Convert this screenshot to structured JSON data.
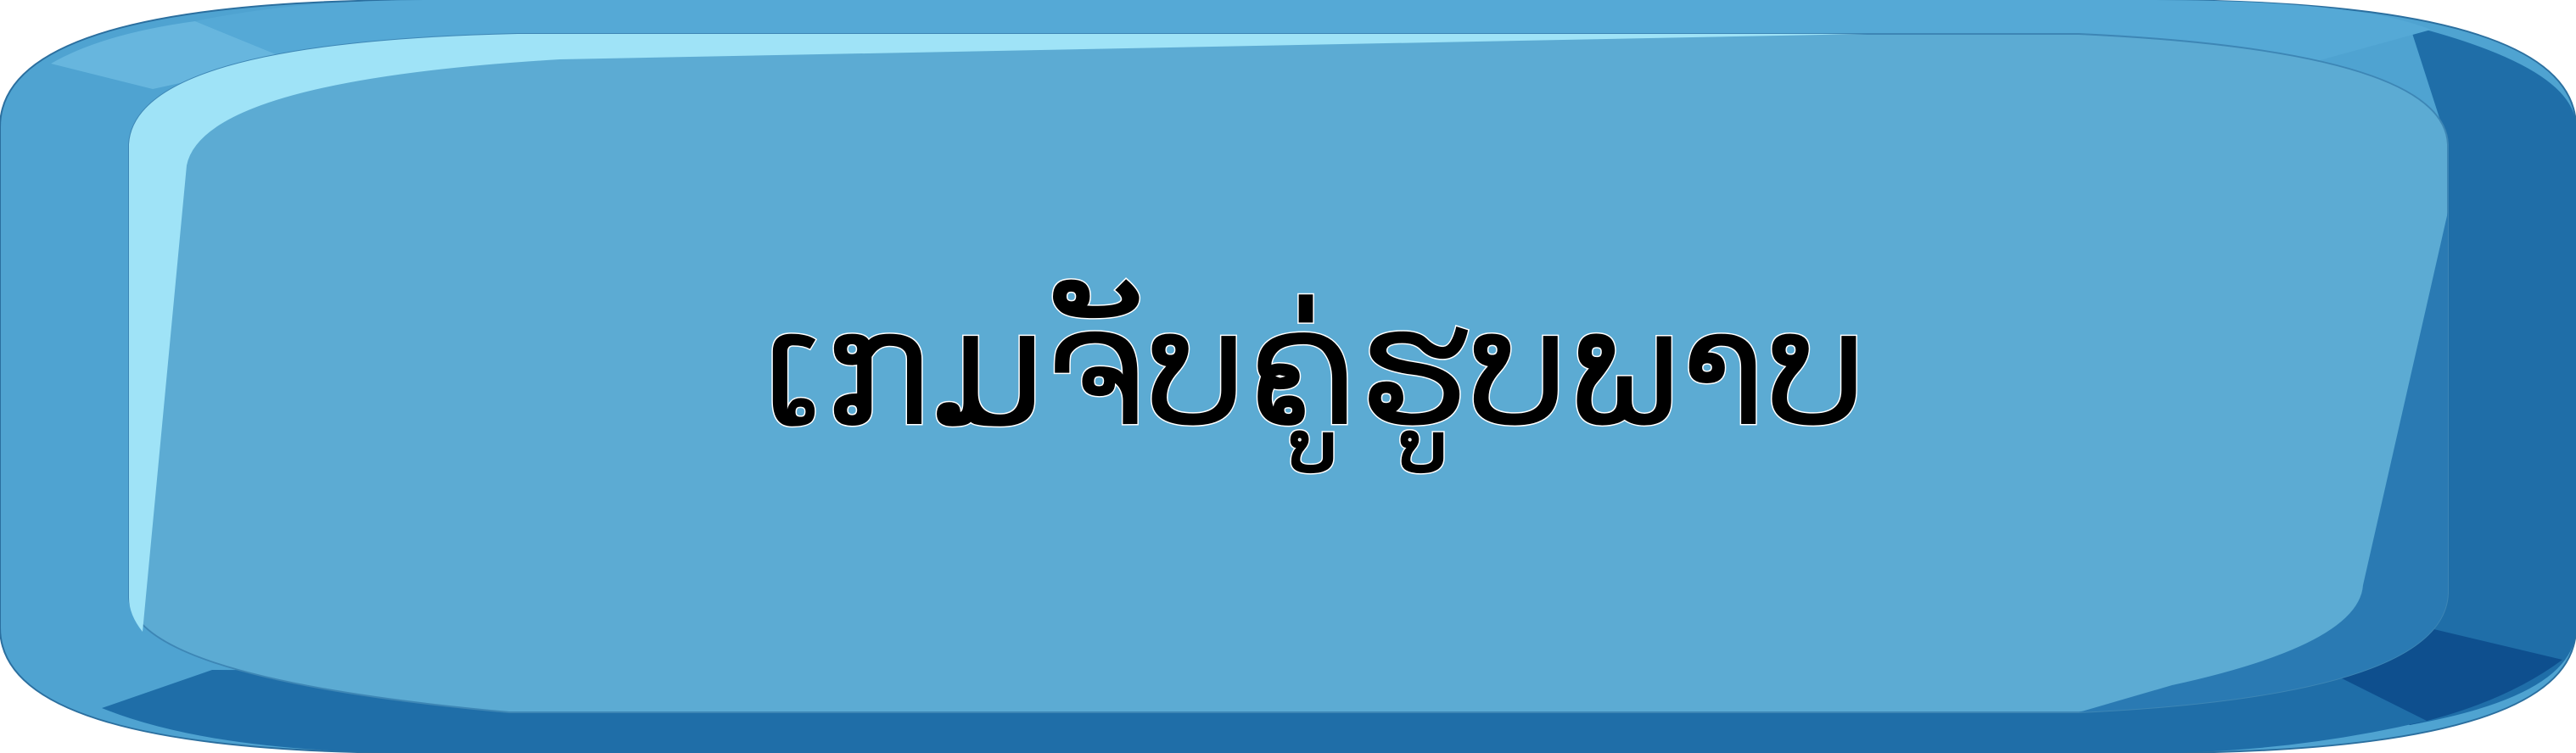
{
  "button": {
    "label": "ເກມຈັບຄູ່ຮູບພາບ"
  },
  "colors": {
    "outer_light": "#4fa3d1",
    "outer_mid": "#67b6de",
    "outer_dark": "#1f6ea8",
    "outer_darkest": "#0e4f8e",
    "face": "#5cabd3",
    "highlight": "#9fe3f7",
    "text": "#000000"
  }
}
